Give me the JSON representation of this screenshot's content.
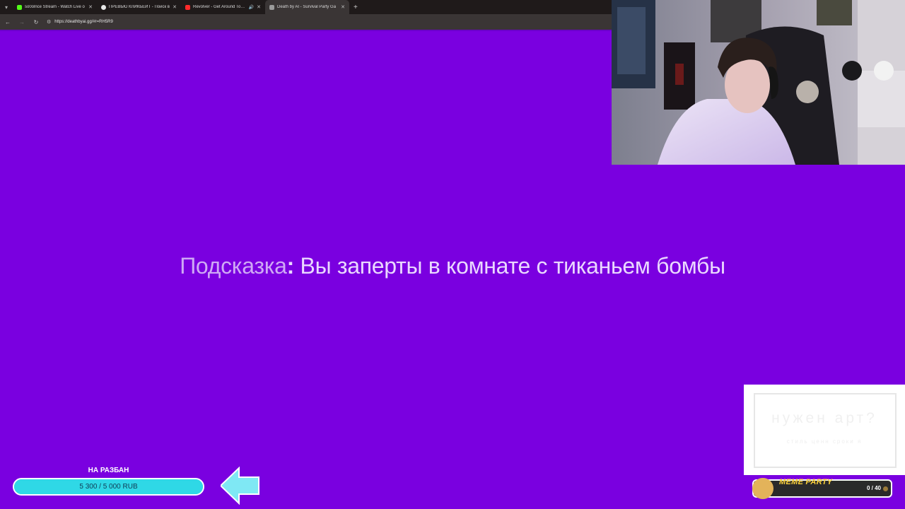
{
  "browser": {
    "tabs": [
      {
        "title": "so0olnce Stream - Watch Live o",
        "favicon_color": "#53fc18",
        "active": false,
        "audio": false
      },
      {
        "title": "ПРЕВЬЮ КЛИКБЕЙТ - Поиск в",
        "favicon_color": "#e8e8e8",
        "active": false,
        "audio": false
      },
      {
        "title": "Revolver - Get Around Town",
        "favicon_color": "#ff2a2a",
        "active": false,
        "audio": true
      },
      {
        "title": "Death by AI - Survival Party Ga",
        "favicon_color": "#9a9a9a",
        "active": true,
        "audio": false
      }
    ],
    "url": "https://deathbyai.gg/#r=RH5R9"
  },
  "game": {
    "hint_label": "Подсказка",
    "hint_colon": ":",
    "hint_text": " Вы заперты в комнате с тиканьем бомбы"
  },
  "overlay": {
    "goal_title": "НА РАЗБАН",
    "goal_progress_text": "5 300 / 5 000 RUB",
    "goal_fraction": 1.0,
    "art_title": "нужен арт?",
    "art_subtitle": "стиль   ценн   сроки   я",
    "meme_title": "MEME PARTY",
    "meme_count": "0 / 40"
  },
  "colors": {
    "page_background": "#7a00e0",
    "goal_bar": "#1ed0e0",
    "meme_title": "#ffd23a"
  }
}
